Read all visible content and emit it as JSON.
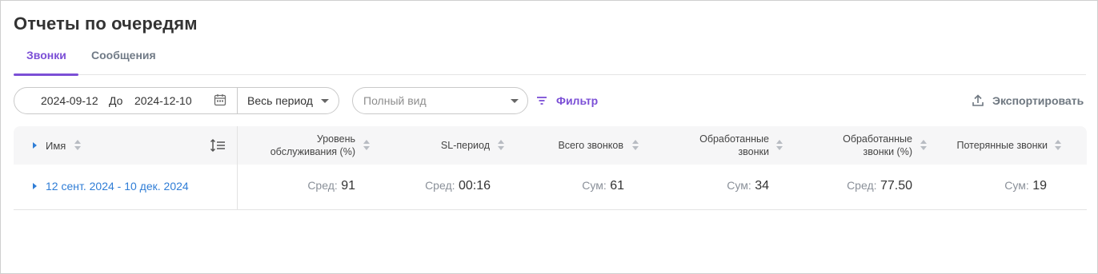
{
  "page": {
    "title": "Отчеты по очередям"
  },
  "tabs": [
    {
      "label": "Звонки",
      "active": true
    },
    {
      "label": "Сообщения",
      "active": false
    }
  ],
  "toolbar": {
    "date_from": "2024-09-12",
    "date_to_label": "До",
    "date_to": "2024-12-10",
    "period": "Весь период",
    "view_placeholder": "Полный вид",
    "filter_label": "Фильтр",
    "export_label": "Экспортировать"
  },
  "table": {
    "columns": [
      {
        "line1": "Имя",
        "line2": ""
      },
      {
        "line1": "Уровень",
        "line2": "обслуживания (%)"
      },
      {
        "line1": "SL-период",
        "line2": ""
      },
      {
        "line1": "Всего звонков",
        "line2": ""
      },
      {
        "line1": "Обработанные",
        "line2": "звонки"
      },
      {
        "line1": "Обработанные",
        "line2": "звонки (%)"
      },
      {
        "line1": "Потерянные звонки",
        "line2": ""
      }
    ],
    "rows": [
      {
        "label": "12 сент. 2024 - 10 дек. 2024",
        "cells": [
          {
            "prefix": "Сред:",
            "value": "91"
          },
          {
            "prefix": "Сред:",
            "value": "00:16"
          },
          {
            "prefix": "Сум:",
            "value": "61"
          },
          {
            "prefix": "Сум:",
            "value": "34"
          },
          {
            "prefix": "Сред:",
            "value": "77.50"
          },
          {
            "prefix": "Сум:",
            "value": "19"
          }
        ]
      }
    ]
  },
  "colors": {
    "accent": "#7b4fd6",
    "link": "#2f7dd6",
    "header_bg": "#f6f6f7"
  },
  "icons": [
    "calendar-icon",
    "caret-down-icon",
    "filter-icon",
    "upload-icon",
    "sort-icon",
    "expand-icon",
    "column-settings-icon"
  ]
}
